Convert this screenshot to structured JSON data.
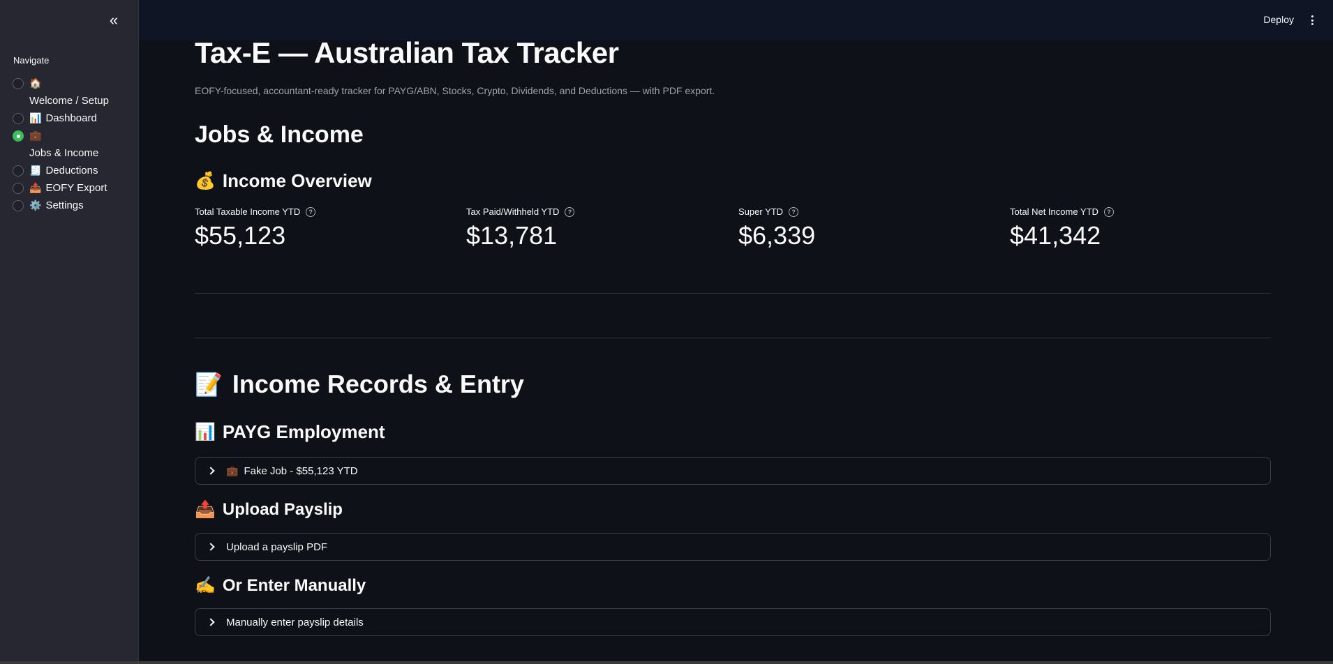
{
  "sidebar": {
    "collapse_icon": "chevrons-left",
    "nav_title": "Navigate",
    "items": [
      {
        "emoji": "🏠",
        "label": "Welcome / Setup",
        "selected": false
      },
      {
        "emoji": "📊",
        "label": "Dashboard",
        "selected": false
      },
      {
        "emoji": "💼",
        "label": "Jobs & Income",
        "selected": true
      },
      {
        "emoji": "🧾",
        "label": "Deductions",
        "selected": false
      },
      {
        "emoji": "📤",
        "label": "EOFY Export",
        "selected": false
      },
      {
        "emoji": "⚙️",
        "label": "Settings",
        "selected": false
      }
    ],
    "accent_color": "#3dbd5b"
  },
  "header": {
    "deploy_label": "Deploy",
    "menu_icon": "kebab-menu"
  },
  "main": {
    "title": "Tax-E — Australian Tax Tracker",
    "subtitle": "EOFY-focused, accountant-ready tracker for PAYG/ABN, Stocks, Crypto, Dividends, and Deductions — with PDF export.",
    "section_title": "Jobs & Income",
    "overview": {
      "emoji": "💰",
      "title": "Income Overview",
      "metrics": [
        {
          "label": "Total Taxable Income YTD",
          "value": "$55,123"
        },
        {
          "label": "Tax Paid/Withheld YTD",
          "value": "$13,781"
        },
        {
          "label": "Super YTD",
          "value": "$6,339"
        },
        {
          "label": "Total Net Income YTD",
          "value": "$41,342"
        }
      ]
    },
    "records": {
      "emoji": "📝",
      "title": "Income Records & Entry"
    },
    "payg": {
      "emoji": "📊",
      "title": "PAYG Employment",
      "expander_emoji": "💼",
      "expander_label": "Fake Job - $55,123 YTD"
    },
    "upload": {
      "emoji": "📤",
      "title": "Upload Payslip",
      "expander_label": "Upload a payslip PDF"
    },
    "manual": {
      "emoji": "✍️",
      "title": "Or Enter Manually",
      "expander_label": "Manually enter payslip details"
    }
  }
}
